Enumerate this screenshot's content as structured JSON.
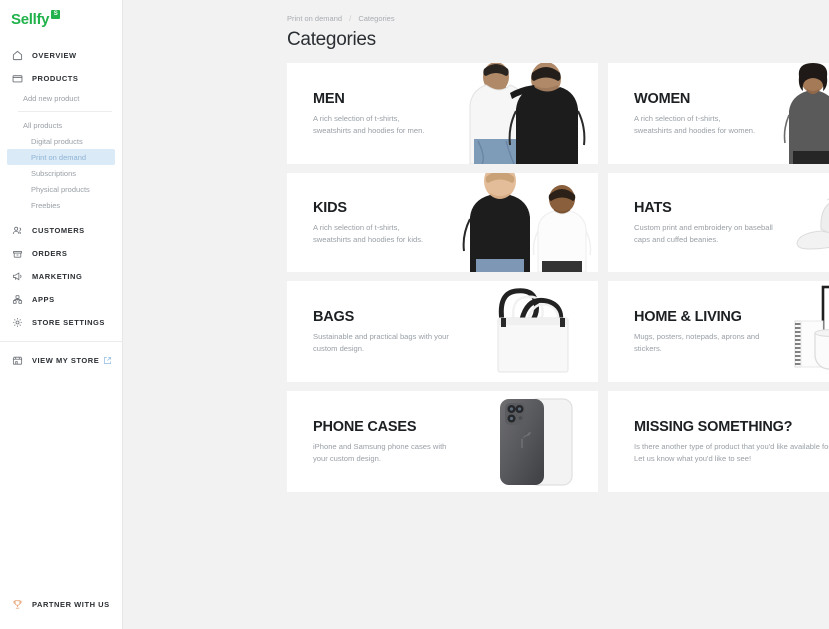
{
  "brand": {
    "name": "Sellfy",
    "badge": "S",
    "color": "#22b24c"
  },
  "sidebar": {
    "nav": [
      {
        "label": "OVERVIEW",
        "icon": "home-icon"
      },
      {
        "label": "PRODUCTS",
        "icon": "folder-icon"
      }
    ],
    "product_links": [
      {
        "label": "Add new product",
        "level": 1,
        "active": false
      },
      {
        "label": "All products",
        "level": 1,
        "active": false
      },
      {
        "label": "Digital products",
        "level": 2,
        "active": false
      },
      {
        "label": "Print on demand",
        "level": 2,
        "active": true
      },
      {
        "label": "Subscriptions",
        "level": 2,
        "active": false
      },
      {
        "label": "Physical products",
        "level": 2,
        "active": false
      },
      {
        "label": "Freebies",
        "level": 2,
        "active": false
      }
    ],
    "nav2": [
      {
        "label": "CUSTOMERS",
        "icon": "customers-icon"
      },
      {
        "label": "ORDERS",
        "icon": "orders-icon"
      },
      {
        "label": "MARKETING",
        "icon": "megaphone-icon"
      },
      {
        "label": "APPS",
        "icon": "apps-icon"
      },
      {
        "label": "STORE SETTINGS",
        "icon": "gear-icon"
      }
    ],
    "store": {
      "label": "VIEW MY STORE",
      "icon": "store-icon",
      "ext_icon": "external-link-icon"
    },
    "partner": {
      "label": "PARTNER WITH US",
      "icon": "trophy-icon",
      "color": "#e8a87c"
    }
  },
  "breadcrumb": {
    "parent": "Print on demand",
    "separator": "/",
    "current": "Categories"
  },
  "page": {
    "title": "Categories"
  },
  "cards": [
    {
      "title": "MEN",
      "desc": "A rich selection of t-shirts, sweatshirts and hoodies for men.",
      "art": "men-photo"
    },
    {
      "title": "WOMEN",
      "desc": "A rich selection of t-shirts, sweatshirts and hoodies for women.",
      "art": "women-photo"
    },
    {
      "title": "KIDS",
      "desc": "A rich selection of t-shirts, sweatshirts and hoodies for kids.",
      "art": "kids-photo"
    },
    {
      "title": "HATS",
      "desc": "Custom print and embroidery on baseball caps and cuffed beanies.",
      "art": "cap-photo"
    },
    {
      "title": "BAGS",
      "desc": "Sustainable and practical bags with your custom design.",
      "art": "tote-bag-photo"
    },
    {
      "title": "HOME & LIVING",
      "desc": "Mugs, posters, notepads, aprons and stickers.",
      "art": "home-living-photo"
    },
    {
      "title": "PHONE CASES",
      "desc": "iPhone and Samsung phone cases with your custom design.",
      "art": "phone-cases-photo"
    },
    {
      "title": "MISSING SOMETHING?",
      "desc": "Is there another type of product that you'd like available for your store?\nLet us know what you'd like to see!",
      "art": "none"
    }
  ]
}
